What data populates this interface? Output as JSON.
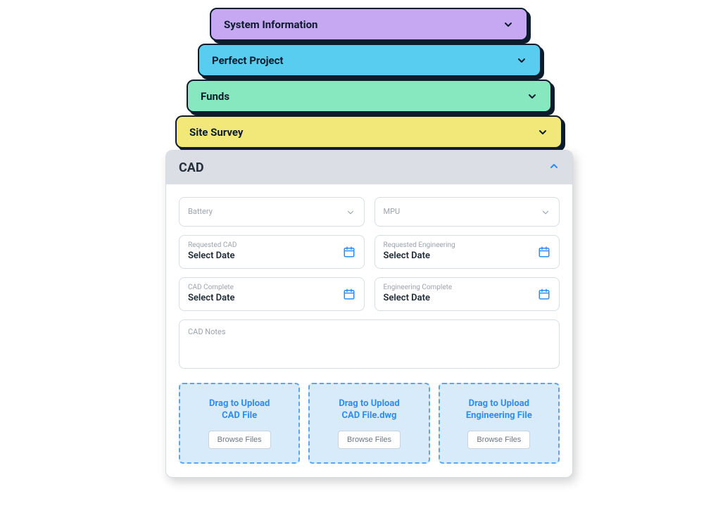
{
  "accordion": {
    "system_info": "System Information",
    "perfect_project": "Perfect Project",
    "funds": "Funds",
    "site_survey": "Site Survey"
  },
  "cad": {
    "title": "CAD",
    "battery_label": "Battery",
    "mpu_label": "MPU",
    "requested_cad_label": "Requested CAD",
    "requested_eng_label": "Requested Engineering",
    "cad_complete_label": "CAD Complete",
    "eng_complete_label": "Engineering Complete",
    "select_date": "Select Date",
    "notes_label": "CAD Notes",
    "uploads": [
      {
        "title1": "Drag to Upload",
        "title2": "CAD File",
        "button": "Browse Files"
      },
      {
        "title1": "Drag to Upload",
        "title2": "CAD File.dwg",
        "button": "Browse Files"
      },
      {
        "title1": "Drag to Upload",
        "title2": "Engineering File",
        "button": "Browse Files"
      }
    ]
  }
}
